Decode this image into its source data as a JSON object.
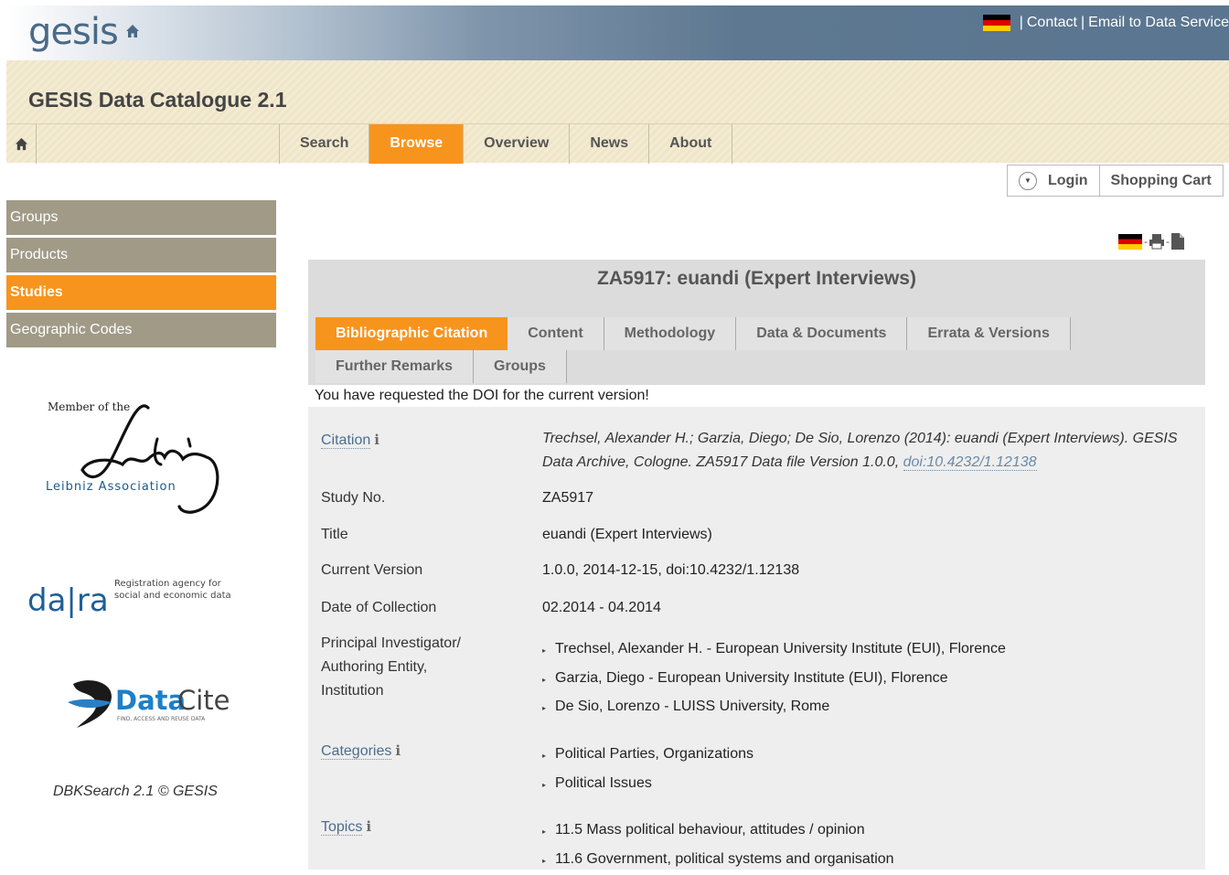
{
  "banner": {
    "logo": "gesis",
    "contact": "Contact",
    "email": "Email to Data Service",
    "separator": "|"
  },
  "header": {
    "catalogue_title": "GESIS Data Catalogue 2.1"
  },
  "nav": {
    "items": [
      {
        "label": "Search"
      },
      {
        "label": "Browse",
        "active": true
      },
      {
        "label": "Overview"
      },
      {
        "label": "News"
      },
      {
        "label": "About"
      }
    ]
  },
  "user": {
    "login": "Login",
    "cart": "Shopping Cart"
  },
  "sidebar": {
    "items": [
      {
        "label": "Groups"
      },
      {
        "label": "Products"
      },
      {
        "label": "Studies",
        "active": true
      },
      {
        "label": "Geographic Codes"
      }
    ],
    "leibniz": {
      "member": "Member of the",
      "association": "Leibniz Association",
      "signature": "Leibniz"
    },
    "dara": {
      "logo": "da|ra",
      "line1": "Registration agency for",
      "line2": "social and economic data"
    },
    "datacite": {
      "logo_a": "Data",
      "logo_b": "Cite",
      "tagline": "FIND, ACCESS AND REUSE DATA"
    },
    "footer": "DBKSearch 2.1 © GESIS"
  },
  "study": {
    "heading": "ZA5917: euandi (Expert Interviews)",
    "tabs_row1": [
      "Bibliographic Citation",
      "Content",
      "Methodology",
      "Data & Documents",
      "Errata & Versions"
    ],
    "tabs_row2": [
      "Further Remarks",
      "Groups"
    ],
    "doi_message": "You have requested the DOI for the current version!",
    "citation_label": "Citation",
    "citation_text": "Trechsel, Alexander H.; Garzia, Diego; De Sio, Lorenzo (2014): euandi (Expert Interviews). GESIS Data Archive, Cologne. ZA5917 Data file Version 1.0.0, ",
    "citation_doi": "doi:10.4232/1.12138",
    "study_no_label": "Study No.",
    "study_no": "ZA5917",
    "title_label": "Title",
    "title": "euandi (Expert Interviews)",
    "version_label": "Current Version",
    "version": "1.0.0, 2014-12-15, doi:10.4232/1.12138",
    "collection_label": "Date of Collection",
    "collection": "02.2014 - 04.2014",
    "pi_label_1": "Principal Investigator/",
    "pi_label_2": "Authoring Entity,",
    "pi_label_3": "Institution",
    "investigators": [
      "Trechsel, Alexander H. - European University Institute (EUI), Florence",
      "Garzia, Diego - European University Institute (EUI), Florence",
      "De Sio, Lorenzo - LUISS University, Rome"
    ],
    "categories_label": "Categories",
    "categories": [
      "Political Parties, Organizations",
      "Political Issues"
    ],
    "topics_label": "Topics",
    "topics": [
      "11.5 Mass political behaviour, attitudes / opinion",
      "11.6 Government, political systems and organisation"
    ]
  }
}
